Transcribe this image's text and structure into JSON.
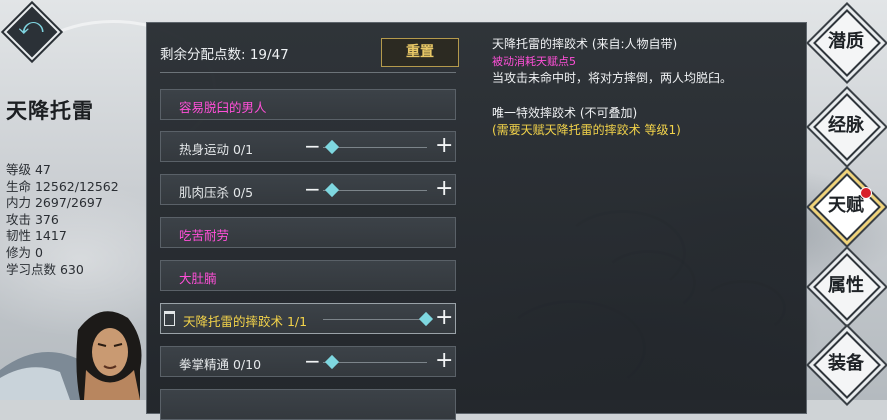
{
  "character": {
    "name": "天降托雷",
    "stats": [
      "等级 47",
      "生命 12562/12562",
      "内力 2697/2697",
      "攻击 376",
      "韧性 1417",
      "修为 0",
      "学习点数 630"
    ]
  },
  "panel": {
    "points_label": "剩余分配点数: 19/47",
    "reset_label": "重置",
    "talents": [
      {
        "label": "容易脱臼的男人",
        "style": "pink",
        "level": null
      },
      {
        "label": "热身运动 0/1",
        "style": "normal",
        "level": 0
      },
      {
        "label": "肌肉压杀 0/5",
        "style": "normal",
        "level": 0
      },
      {
        "label": "吃苦耐劳",
        "style": "pink",
        "level": null
      },
      {
        "label": "大肚腩",
        "style": "pink",
        "level": null
      },
      {
        "label": "天降托雷的摔跤术 1/1",
        "style": "gold",
        "level": 1
      },
      {
        "label": "拳掌精通 0/10",
        "style": "normal",
        "level": 0
      }
    ]
  },
  "description": {
    "title": "天降托雷的摔跤术 (来自:人物自带)",
    "cost": "被动消耗天赋点5",
    "effect": "当攻击未命中时，将对方摔倒，两人均脱臼。",
    "unique": "唯一特效摔跤术 (不可叠加)",
    "requirement": "(需要天赋天降托雷的摔跤术 等级1)"
  },
  "tabs": [
    "潜质",
    "经脉",
    "天赋",
    "属性",
    "装备"
  ],
  "active_tab": "天赋",
  "colors": {
    "highlight_pink": "#ff4fd8",
    "highlight_gold": "#f3d34a",
    "accent_cyan": "#7ed7e0"
  },
  "icons": {
    "back": "back-arrow-icon",
    "remove": "trash-icon",
    "decrement": "minus-icon",
    "increment": "plus-icon"
  }
}
